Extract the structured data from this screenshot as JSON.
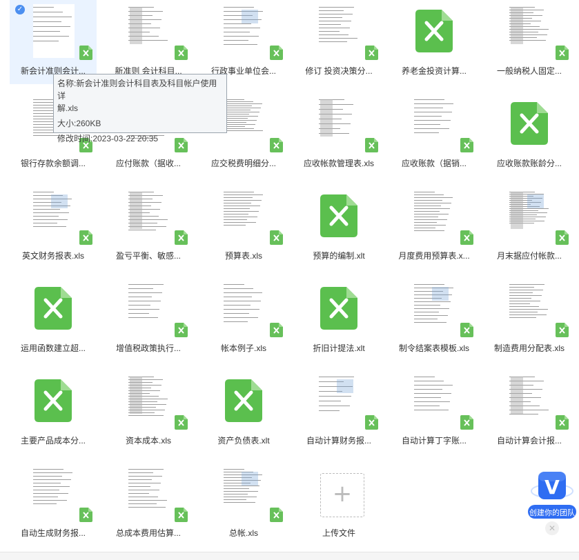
{
  "files": [
    {
      "label": "新会计准则会计...",
      "thumb": "sheet",
      "selected": true
    },
    {
      "label": "新准则 会计科目...",
      "thumb": "sheet"
    },
    {
      "label": "行政事业单位会...",
      "thumb": "sheet"
    },
    {
      "label": "修订 投资决策分...",
      "thumb": "sheet"
    },
    {
      "label": "养老金投资计算...",
      "thumb": "icon"
    },
    {
      "label": "一般纳税人固定...",
      "thumb": "sheet"
    },
    {
      "label": "银行存款余额调...",
      "thumb": "sheet"
    },
    {
      "label": "应付账款（据收...",
      "thumb": "sheet"
    },
    {
      "label": "应交税费明细分...",
      "thumb": "sheet"
    },
    {
      "label": "应收帐款管理表.xls",
      "thumb": "sheet"
    },
    {
      "label": "应收账款（据销...",
      "thumb": "sheet"
    },
    {
      "label": "应收账款账龄分...",
      "thumb": "icon"
    },
    {
      "label": "英文财务报表.xls",
      "thumb": "sheet"
    },
    {
      "label": "盈亏平衡、敏感...",
      "thumb": "sheet"
    },
    {
      "label": "预算表.xls",
      "thumb": "sheet"
    },
    {
      "label": "预算的编制.xlt",
      "thumb": "icon"
    },
    {
      "label": "月度费用预算表.x...",
      "thumb": "sheet"
    },
    {
      "label": "月末据应付帐款...",
      "thumb": "sheet"
    },
    {
      "label": "运用函数建立超...",
      "thumb": "icon"
    },
    {
      "label": "增值税政策执行...",
      "thumb": "sheet"
    },
    {
      "label": "帐本例子.xls",
      "thumb": "sheet"
    },
    {
      "label": "折旧计提法.xlt",
      "thumb": "icon"
    },
    {
      "label": "制令结案表模板.xls",
      "thumb": "sheet"
    },
    {
      "label": "制造费用分配表.xls",
      "thumb": "sheet"
    },
    {
      "label": "主要产品成本分...",
      "thumb": "icon"
    },
    {
      "label": "资本成本.xls",
      "thumb": "sheet"
    },
    {
      "label": "资产负债表.xlt",
      "thumb": "icon"
    },
    {
      "label": "自动计算财务报...",
      "thumb": "sheet"
    },
    {
      "label": "自动计算丁字账...",
      "thumb": "sheet"
    },
    {
      "label": "自动计算会计报...",
      "thumb": "sheet"
    },
    {
      "label": "自动生成财务报...",
      "thumb": "sheet"
    },
    {
      "label": "总成本费用估算...",
      "thumb": "sheet"
    },
    {
      "label": "总帐.xls",
      "thumb": "sheet"
    }
  ],
  "upload": {
    "label": "上传文件"
  },
  "tooltip": {
    "name_line1": "名称:新会计准则会计科目表及科目帐户使用详",
    "name_line2": "解.xls",
    "size": "大小:260KB",
    "modified": "修改时间:2023-03-22 20:35"
  },
  "promo": {
    "text": "创建你的团队",
    "logo_letter": "V"
  },
  "colors": {
    "excel_green": "#5bbf4e",
    "badge_green": "#67c05a",
    "selected_bg": "#eaf3ff",
    "check_blue": "#4c8ff0"
  }
}
